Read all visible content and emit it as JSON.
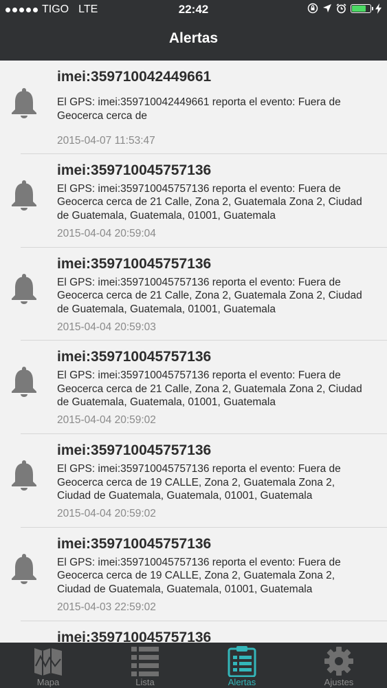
{
  "status_bar": {
    "carrier": "TIGO",
    "network": "LTE",
    "time": "22:42"
  },
  "header": {
    "title": "Alertas"
  },
  "alerts": [
    {
      "imei": "imei:359710042449661",
      "message": "El GPS: imei:359710042449661 reporta el evento: Fuera de Geocerca cerca de",
      "date": "2015-04-07 11:53:47"
    },
    {
      "imei": "imei:359710045757136",
      "message": "El GPS: imei:359710045757136 reporta el evento: Fuera de Geocerca cerca de 21 Calle, Zona 2, Guatemala Zona 2, Ciudad de Guatemala, Guatemala, 01001, Guatemala",
      "date": "2015-04-04 20:59:04"
    },
    {
      "imei": "imei:359710045757136",
      "message": "El GPS: imei:359710045757136 reporta el evento: Fuera de Geocerca cerca de 21 Calle, Zona 2, Guatemala Zona 2, Ciudad de Guatemala, Guatemala, 01001, Guatemala",
      "date": "2015-04-04 20:59:03"
    },
    {
      "imei": "imei:359710045757136",
      "message": "El GPS: imei:359710045757136 reporta el evento: Fuera de Geocerca cerca de 21 Calle, Zona 2, Guatemala Zona 2, Ciudad de Guatemala, Guatemala, 01001, Guatemala",
      "date": "2015-04-04 20:59:02"
    },
    {
      "imei": "imei:359710045757136",
      "message": "El GPS: imei:359710045757136 reporta el evento: Fuera de Geocerca cerca de 19 CALLE, Zona 2, Guatemala Zona 2, Ciudad de Guatemala, Guatemala, 01001, Guatemala",
      "date": "2015-04-04 20:59:02"
    },
    {
      "imei": "imei:359710045757136",
      "message": "El GPS: imei:359710045757136 reporta el evento: Fuera de Geocerca cerca de 19 CALLE, Zona 2, Guatemala Zona 2, Ciudad de Guatemala, Guatemala, 01001, Guatemala",
      "date": "2015-04-03 22:59:02"
    },
    {
      "imei": "imei:359710045757136",
      "message": "",
      "date": ""
    }
  ],
  "tabs": [
    {
      "label": "Mapa",
      "icon": "map-icon",
      "active": false
    },
    {
      "label": "Lista",
      "icon": "list-icon",
      "active": false
    },
    {
      "label": "Alertas",
      "icon": "clipboard-icon",
      "active": true
    },
    {
      "label": "Ajustes",
      "icon": "gear-icon",
      "active": false
    }
  ],
  "colors": {
    "nav_background": "#303234",
    "accent": "#33b6ba",
    "battery": "#4cd964"
  }
}
